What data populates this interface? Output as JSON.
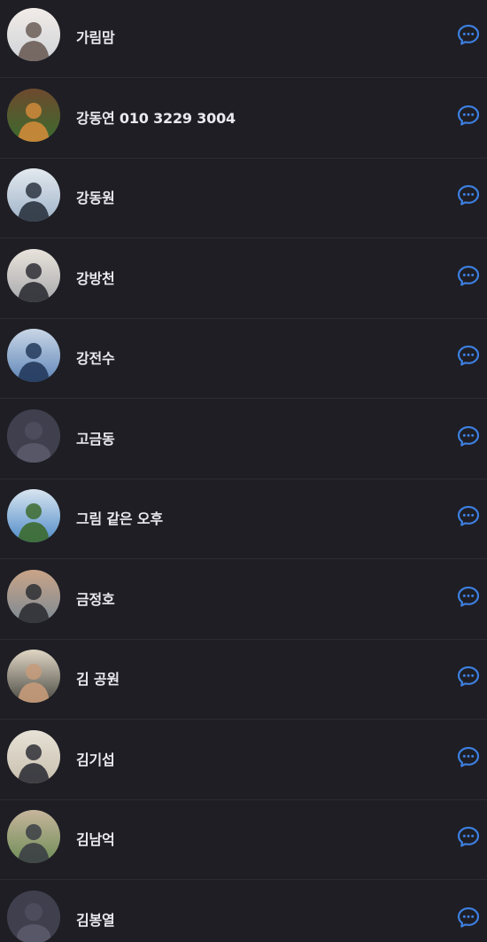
{
  "contacts": [
    {
      "name": "가림맘",
      "avatar": "photo",
      "palette": [
        "#cfd3d8",
        "#6b5d57",
        "#f2ece8"
      ]
    },
    {
      "name": "강동연 010 3229 3004",
      "avatar": "photo",
      "palette": [
        "#3b6b2e",
        "#d08a3a",
        "#6e4a2e"
      ]
    },
    {
      "name": "강동원",
      "avatar": "photo",
      "palette": [
        "#9fb3c9",
        "#2b3440",
        "#e3e9ef"
      ]
    },
    {
      "name": "강방천",
      "avatar": "photo",
      "palette": [
        "#a9a9ad",
        "#2e2e35",
        "#e8e3db"
      ]
    },
    {
      "name": "강전수",
      "avatar": "photo",
      "palette": [
        "#5f86b9",
        "#243a5c",
        "#c9d6e6"
      ]
    },
    {
      "name": "고금동",
      "avatar": "default",
      "palette": [
        "#3f3f4e",
        "#4c4c5c",
        "#575768"
      ]
    },
    {
      "name": "그림 같은 오후",
      "avatar": "photo",
      "palette": [
        "#4f8bc9",
        "#3d6b2f",
        "#d8e5ef"
      ]
    },
    {
      "name": "금정호",
      "avatar": "photo",
      "palette": [
        "#7d8a95",
        "#2d2f34",
        "#c9a487"
      ]
    },
    {
      "name": "김 공원",
      "avatar": "photo",
      "palette": [
        "#4a4a43",
        "#c79b7a",
        "#e0d6c4"
      ]
    },
    {
      "name": "김기섭",
      "avatar": "photo",
      "palette": [
        "#c8bfae",
        "#2f3037",
        "#e7e2d6"
      ]
    },
    {
      "name": "김남억",
      "avatar": "photo",
      "palette": [
        "#6d8d56",
        "#3b3f45",
        "#c7b59c"
      ]
    },
    {
      "name": "김봉열",
      "avatar": "default",
      "palette": [
        "#3f3f4e",
        "#4c4c5c",
        "#575768"
      ]
    }
  ],
  "colors": {
    "background": "#1e1e24",
    "text": "#e9e9ee",
    "divider": "#2c2c33",
    "chat_icon": "#3d7fe0"
  },
  "icons": {
    "chat": "chat-bubble-dots-icon",
    "default_avatar": "person-silhouette-icon"
  }
}
